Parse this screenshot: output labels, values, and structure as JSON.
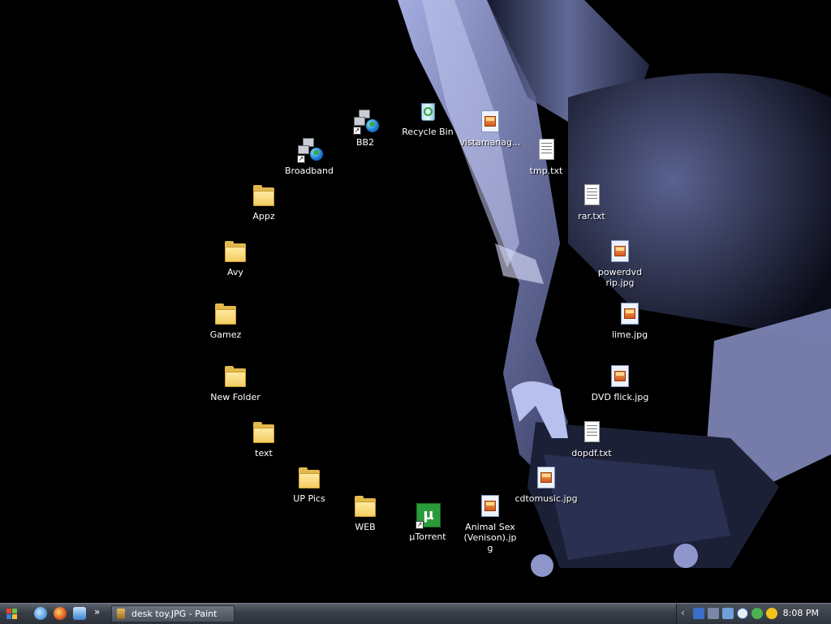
{
  "desktop": {
    "icons": [
      {
        "label": "BB2",
        "type": "network"
      },
      {
        "label": "Recycle Bin",
        "type": "recycle-bin"
      },
      {
        "label": "vistamanag...",
        "type": "image-file"
      },
      {
        "label": "Broadband",
        "type": "network"
      },
      {
        "label": "tmp.txt",
        "type": "text-file"
      },
      {
        "label": "Appz",
        "type": "folder"
      },
      {
        "label": "rar.txt",
        "type": "text-file"
      },
      {
        "label": "Avy",
        "type": "folder"
      },
      {
        "label": "powerdvd rip.jpg",
        "type": "image-file"
      },
      {
        "label": "Gamez",
        "type": "folder"
      },
      {
        "label": "lime.jpg",
        "type": "image-file"
      },
      {
        "label": "New Folder",
        "type": "folder"
      },
      {
        "label": "DVD flick.jpg",
        "type": "image-file"
      },
      {
        "label": "text",
        "type": "folder"
      },
      {
        "label": "dopdf.txt",
        "type": "text-file"
      },
      {
        "label": "UP Pics",
        "type": "folder"
      },
      {
        "label": "cdtomusic.jpg",
        "type": "image-file"
      },
      {
        "label": "WEB",
        "type": "folder"
      },
      {
        "label": "µTorrent",
        "type": "utorrent"
      },
      {
        "label": "Animal Sex (Venison).jpg",
        "type": "image-file"
      }
    ]
  },
  "taskbar": {
    "quick_launch": [
      "internet-explorer-icon",
      "firefox-icon",
      "desktop-icon"
    ],
    "tasks": [
      {
        "label": "desk toy.JPG - Paint"
      }
    ],
    "clock": "8:08 PM"
  }
}
